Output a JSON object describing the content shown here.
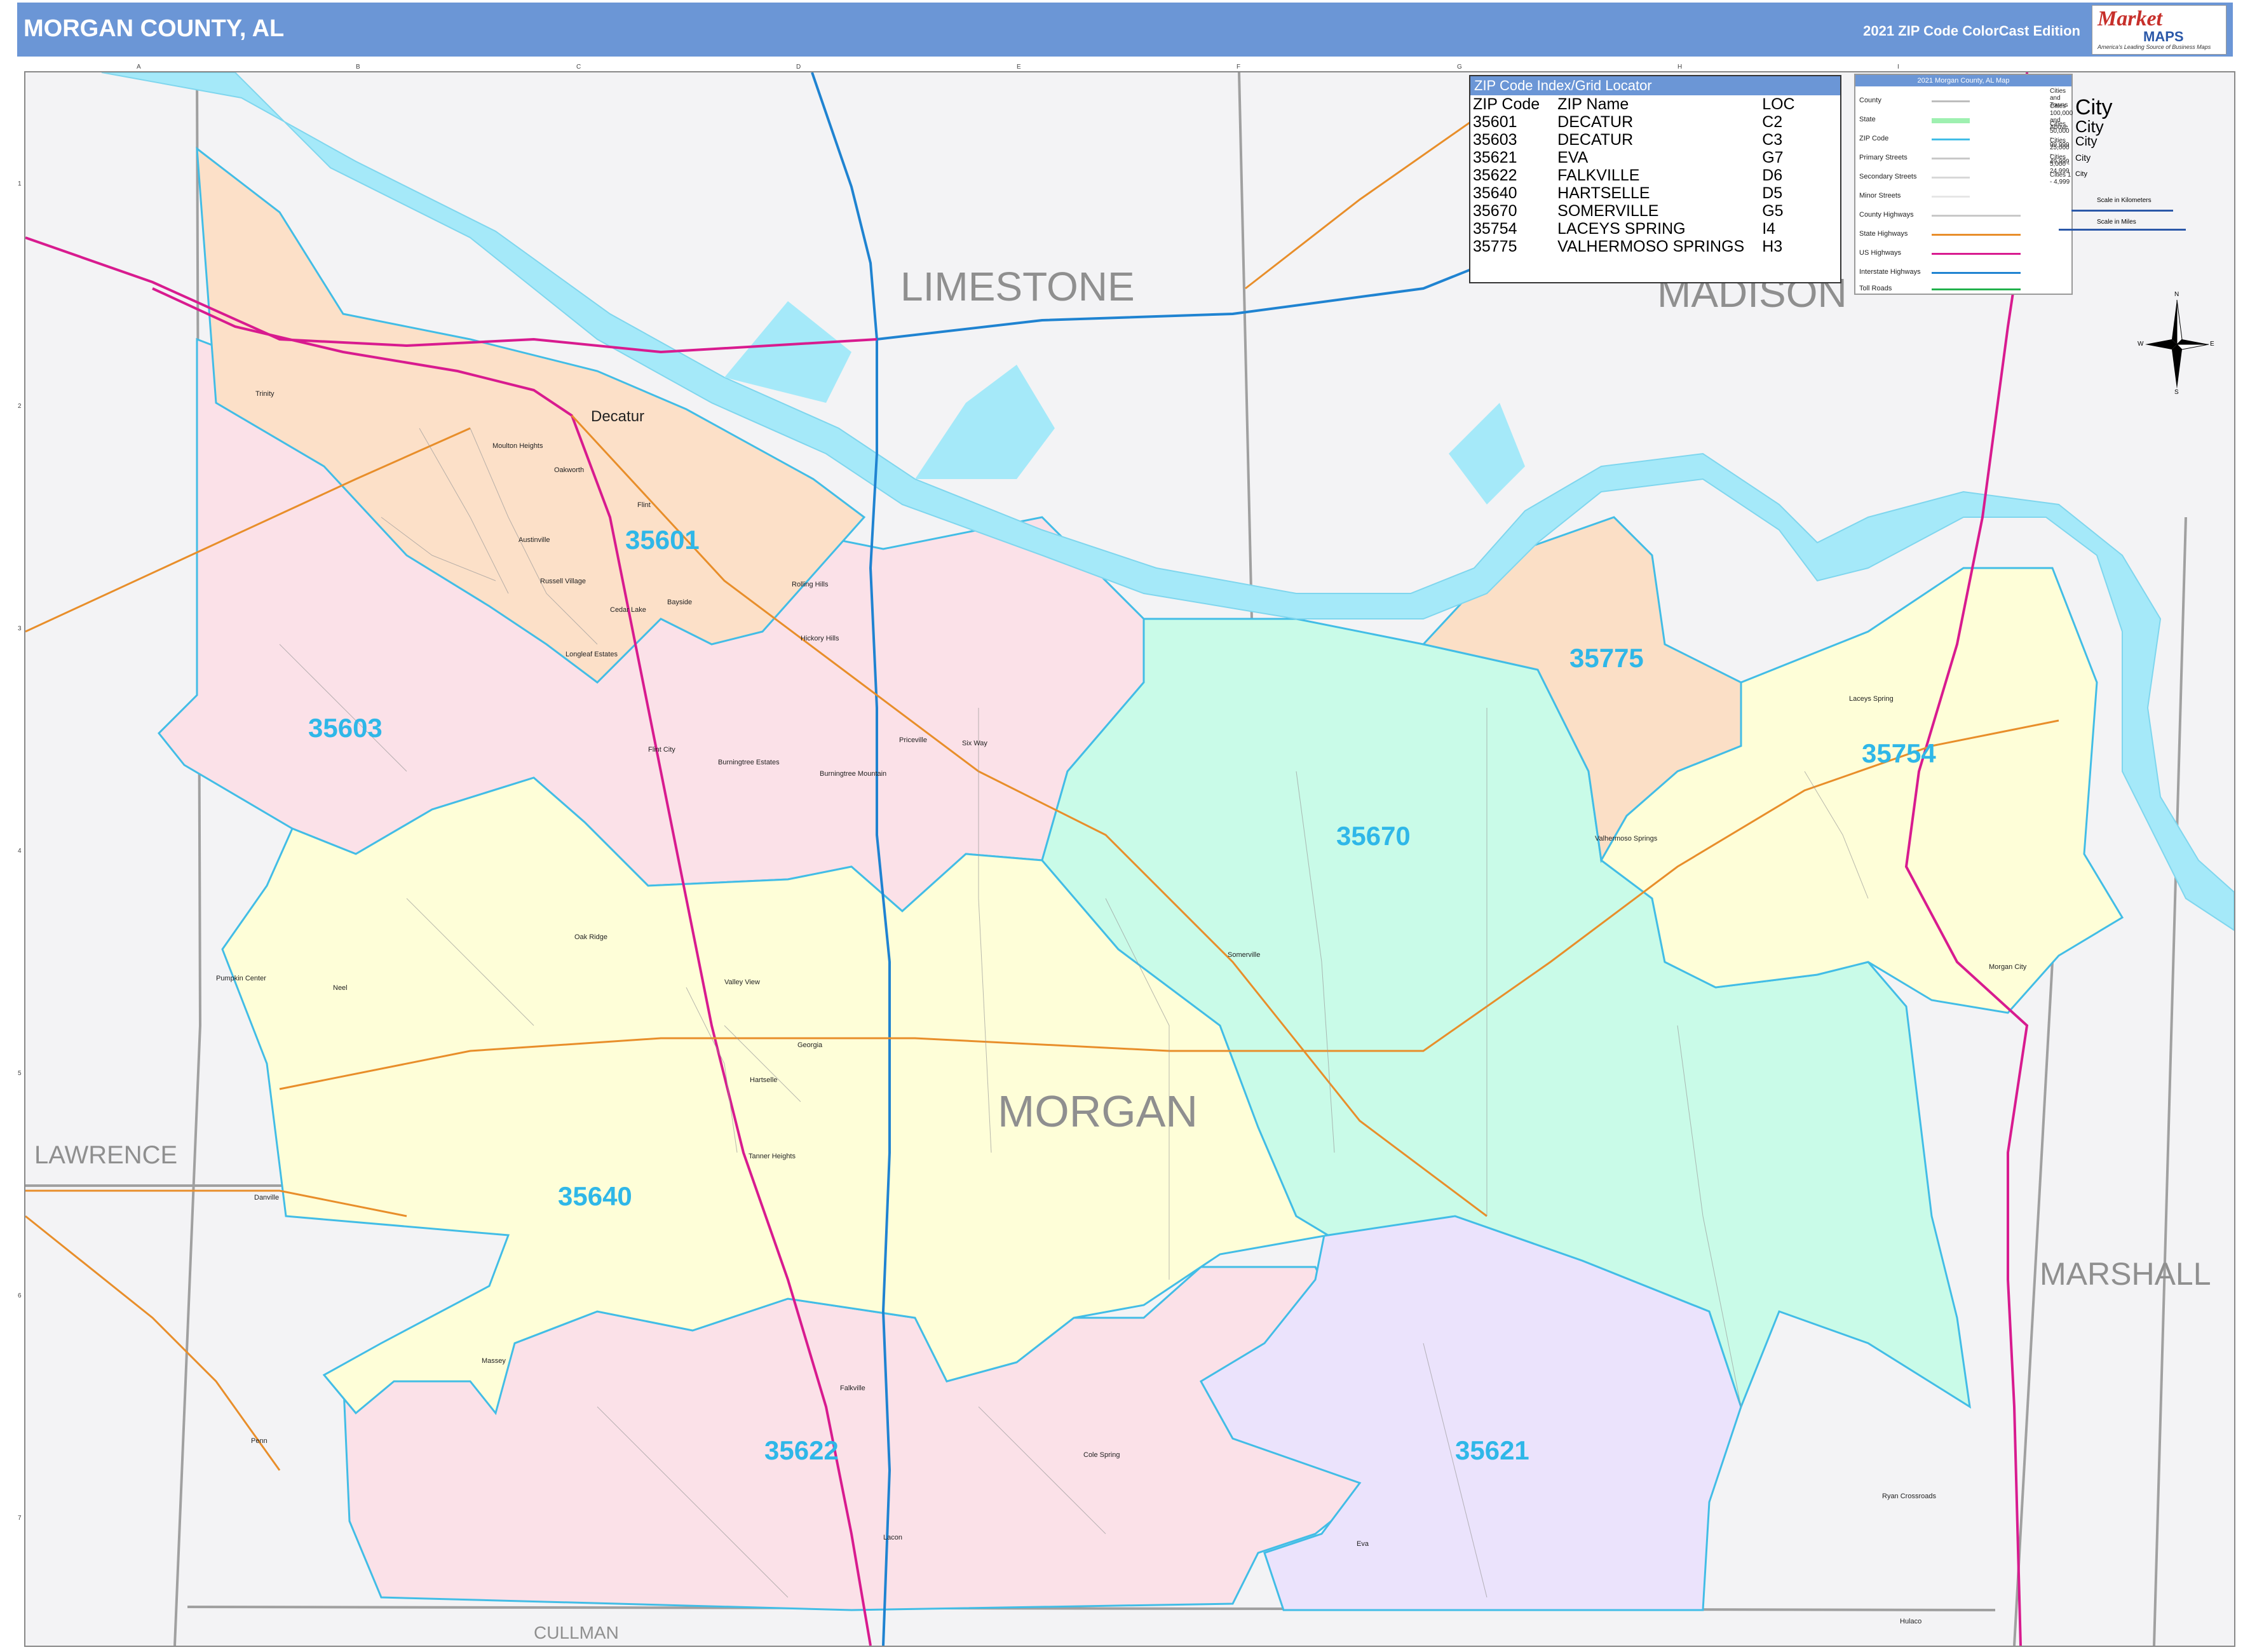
{
  "header": {
    "title": "MORGAN COUNTY, AL",
    "edition": "2021 ZIP Code ColorCast Edition",
    "logo_word": "Market",
    "logo_maps": "MAPS",
    "logo_tagline": "America's Leading Source of Business Maps"
  },
  "colors": {
    "header_bg": "#6b96d6",
    "water": "#a5e9f9",
    "zip_35601": "#fce0c8",
    "zip_35603": "#fbe1e8",
    "zip_35640": "#fefed8",
    "zip_35670": "#c9fbe8",
    "zip_35775": "#fbdfc6",
    "zip_35754": "#fefed8",
    "zip_35621": "#ebe3fc",
    "zip_35622": "#fbe1e8",
    "zip_label": "#2fb7e8",
    "zip_border": "#42bde6",
    "interstate": "#1f83d1",
    "us_highway": "#d81b8f",
    "state_highway": "#e88e2a"
  },
  "counties": {
    "morgan": "MORGAN",
    "limestone": "LIMESTONE",
    "madison": "MADISON",
    "lawrence": "LAWRENCE",
    "marshall": "MARSHALL",
    "cullman": "CULLMAN"
  },
  "zip_labels": {
    "z35601": "35601",
    "z35603": "35603",
    "z35640": "35640",
    "z35670": "35670",
    "z35775": "35775",
    "z35754": "35754",
    "z35621": "35621",
    "z35622": "35622"
  },
  "cities": {
    "decatur": "Decatur",
    "mouton_heights": "Moulton Heights",
    "oakworth": "Oakworth",
    "flint": "Flint",
    "austinville": "Austinville",
    "russell_village": "Russell Village",
    "cedar_lake": "Cedar Lake",
    "bayside": "Bayside",
    "longleaf_estates": "Longleaf Estates",
    "flint_city": "Flint City",
    "rolling_hills": "Rolling Hills",
    "hickory_hills": "Hickory Hills",
    "priceville": "Priceville",
    "six_way": "Six Way",
    "burningtree_estates": "Burningtree Estates",
    "burningtree_mountain": "Burningtree Mountain",
    "trinity": "Trinity",
    "oak_ridge": "Oak Ridge",
    "neel": "Neel",
    "pumpkin_center": "Pumpkin Center",
    "valley_view": "Valley View",
    "georgia": "Georgia",
    "hartselle": "Hartselle",
    "tanner_heights": "Tanner Heights",
    "danville": "Danville",
    "somerville": "Somerville",
    "laceys_spring": "Laceys Spring",
    "valhermoso_springs": "Valhermoso Springs",
    "morgan_city": "Morgan City",
    "massey": "Massey",
    "falkville": "Falkville",
    "cole_spring": "Cole Spring",
    "penn": "Penn",
    "lacon": "Lacon",
    "eva": "Eva",
    "ryan_crossroads": "Ryan Crossroads",
    "hulaco": "Hulaco"
  },
  "grid_letters": [
    "A",
    "B",
    "C",
    "D",
    "E",
    "F",
    "G",
    "H",
    "I"
  ],
  "grid_numbers": [
    "1",
    "2",
    "3",
    "4",
    "5",
    "6",
    "7"
  ],
  "zip_index": {
    "title": "ZIP Code Index/Grid Locator",
    "headers": [
      "ZIP Code",
      "ZIP Name",
      "LOC"
    ],
    "rows": [
      [
        "35601",
        "DECATUR",
        "C2"
      ],
      [
        "35603",
        "DECATUR",
        "C3"
      ],
      [
        "35621",
        "EVA",
        "G7"
      ],
      [
        "35622",
        "FALKVILLE",
        "D6"
      ],
      [
        "35640",
        "HARTSELLE",
        "D5"
      ],
      [
        "35670",
        "SOMERVILLE",
        "G5"
      ],
      [
        "35754",
        "LACEYS SPRING",
        "I4"
      ],
      [
        "35775",
        "VALHERMOSO SPRINGS",
        "H3"
      ]
    ]
  },
  "legend": {
    "title": "2021 Morgan County, AL Map",
    "items": [
      {
        "label": "County",
        "color": "#bdbdbd"
      },
      {
        "label": "State",
        "color": "#9ef0b0"
      },
      {
        "label": "ZIP Code",
        "color": "#42bde6"
      },
      {
        "label": "Primary Streets",
        "color": "#c8c8c8"
      },
      {
        "label": "Secondary Streets",
        "color": "#d8d8d8"
      },
      {
        "label": "Minor Streets",
        "color": "#e6e6e6"
      },
      {
        "label": "County Highways",
        "color": "#c8c8c8"
      },
      {
        "label": "State Highways",
        "color": "#e88e2a"
      },
      {
        "label": "US Highways",
        "color": "#d81b8f"
      },
      {
        "label": "Interstate Highways",
        "color": "#1f83d1"
      },
      {
        "label": "Toll Roads",
        "color": "#22b14c"
      }
    ],
    "city_header": "Cities and Towns",
    "city_sizes": [
      {
        "label": "Cities 100,000 and Above",
        "sample": "City"
      },
      {
        "label": "Cities 50,000 - 99,999",
        "sample": "City"
      },
      {
        "label": "Cities 25,000 - 49,999",
        "sample": "City"
      },
      {
        "label": "Cities 5,000 - 24,999",
        "sample": "City"
      },
      {
        "label": "Cities 1 - 4,999",
        "sample": "City"
      }
    ],
    "scale_km": "Scale in Kilometers",
    "scale_mi": "Scale in Miles"
  },
  "compass": {
    "n": "N",
    "s": "S",
    "e": "E",
    "w": "W"
  }
}
